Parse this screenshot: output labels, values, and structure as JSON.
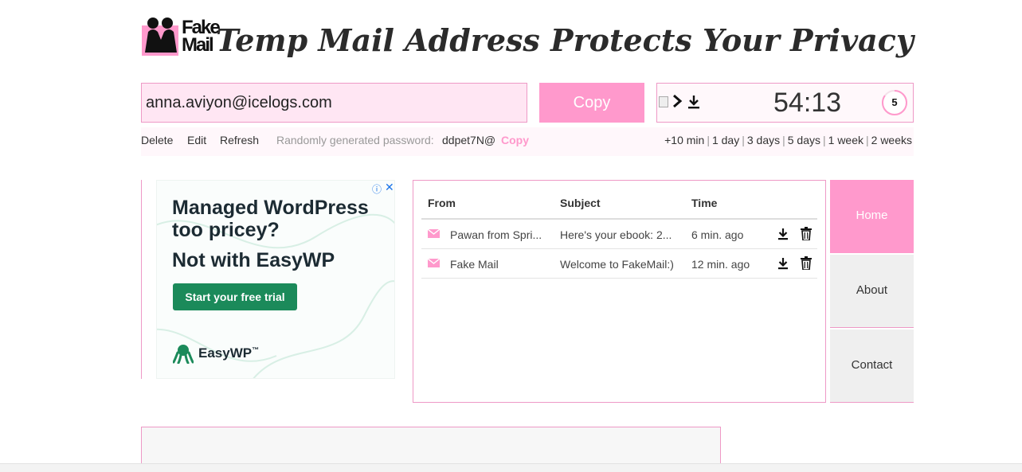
{
  "brand": {
    "logo_line1": "Fake",
    "logo_line2": "Mail",
    "tagline": "Temp Mail Address Protects Your Privacy",
    "accent": "#ff99cc",
    "light_bg": "#ffe6f3"
  },
  "address": {
    "email": "anna.aviyon@icelogs.com",
    "copy_label": "Copy"
  },
  "timer": {
    "value": "54:13",
    "count": "5",
    "count_progress": 0.85
  },
  "actions": {
    "delete": "Delete",
    "edit": "Edit",
    "refresh": "Refresh"
  },
  "password": {
    "label": "Randomly generated password:",
    "value": "ddpet7N@",
    "copy_label": "Copy"
  },
  "durations": [
    "+10 min",
    "1 day",
    "3 days",
    "5 days",
    "1 week",
    "2 weeks"
  ],
  "ad": {
    "headline": "Managed WordPress too pricey?",
    "subhead": "Not with EasyWP",
    "cta": "Start your free trial",
    "brand": "EasyWP",
    "brand_tm": "™",
    "info_icon": "ⓘ",
    "close_icon": "✕"
  },
  "inbox": {
    "columns": [
      "From",
      "Subject",
      "Time"
    ],
    "rows": [
      {
        "from": "Pawan from Spri...",
        "subject": "Here's your ebook: 2...",
        "time": "6 min. ago"
      },
      {
        "from": "Fake Mail",
        "subject": "Welcome to FakeMail:)",
        "time": "12 min. ago"
      }
    ]
  },
  "nav": {
    "home": "Home",
    "about": "About",
    "contact": "Contact"
  }
}
